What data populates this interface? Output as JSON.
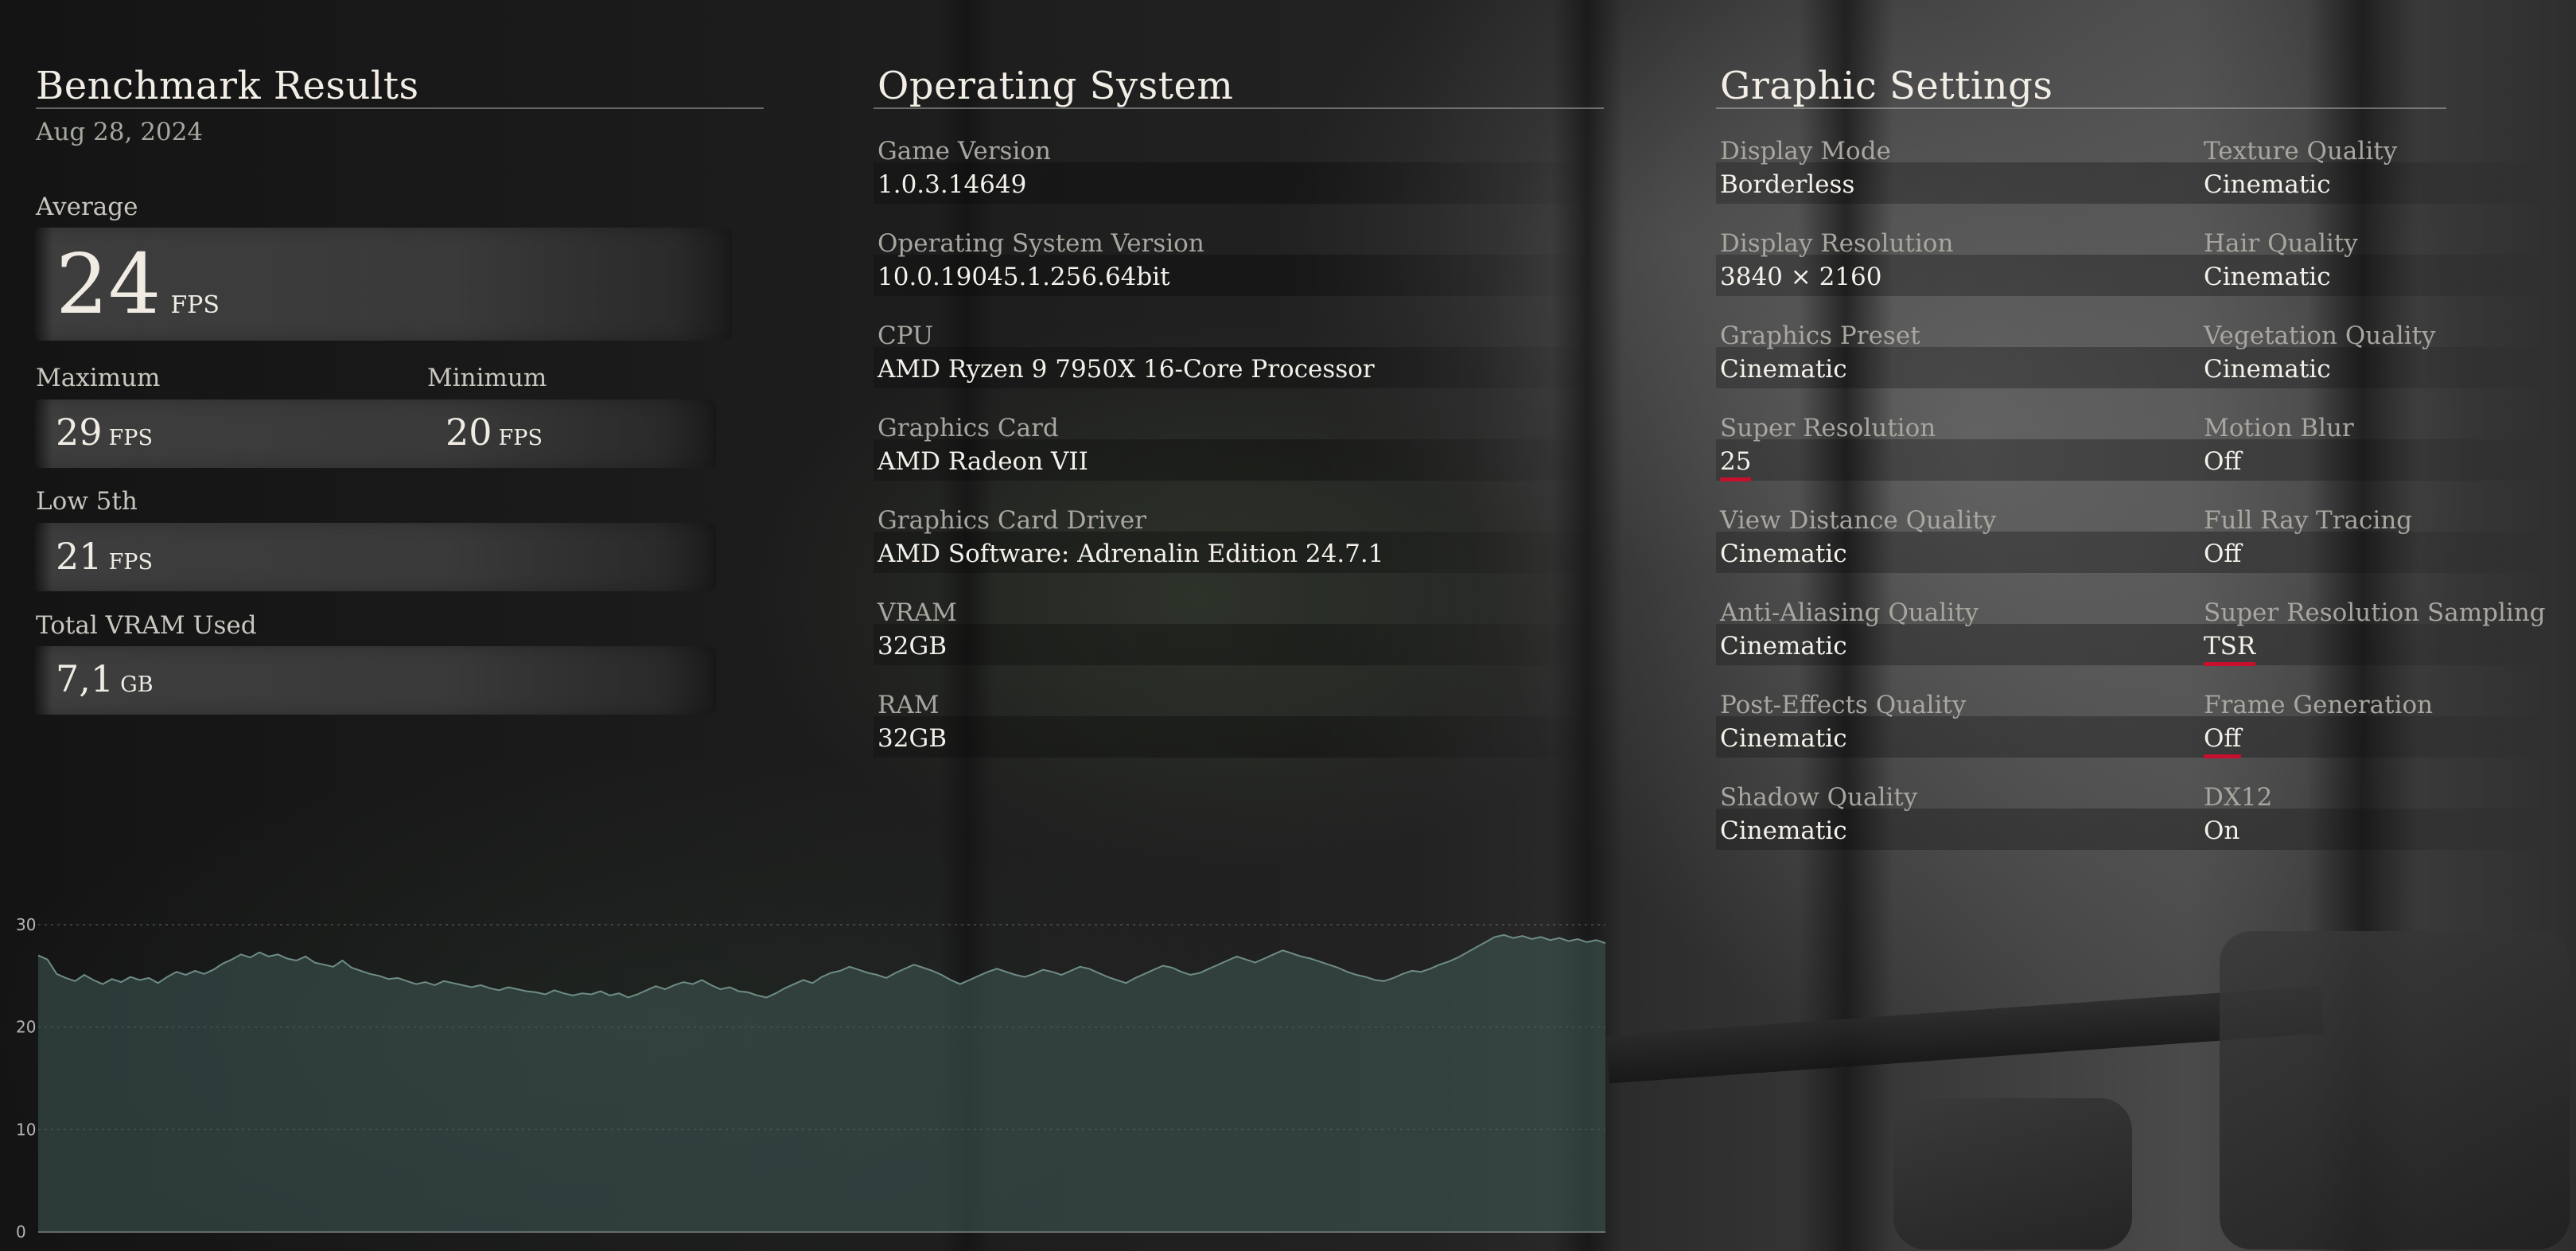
{
  "benchmark": {
    "title": "Benchmark Results",
    "date": "Aug 28, 2024",
    "average": {
      "label": "Average",
      "value": "24",
      "unit": "FPS"
    },
    "maximum": {
      "label": "Maximum",
      "value": "29",
      "unit": "FPS"
    },
    "minimum": {
      "label": "Minimum",
      "value": "20",
      "unit": "FPS"
    },
    "low5": {
      "label": "Low 5th",
      "value": "21",
      "unit": "FPS"
    },
    "vram_used": {
      "label": "Total VRAM Used",
      "value": "7,1",
      "unit": "GB"
    }
  },
  "os": {
    "title": "Operating System",
    "fields": [
      {
        "label": "Game Version",
        "value": "1.0.3.14649"
      },
      {
        "label": "Operating System Version",
        "value": "10.0.19045.1.256.64bit"
      },
      {
        "label": "CPU",
        "value": "AMD Ryzen 9 7950X 16-Core Processor"
      },
      {
        "label": "Graphics Card",
        "value": "AMD Radeon VII"
      },
      {
        "label": "Graphics Card Driver",
        "value": "AMD Software: Adrenalin Edition 24.7.1"
      },
      {
        "label": "VRAM",
        "value": "32GB"
      },
      {
        "label": "RAM",
        "value": "32GB"
      }
    ]
  },
  "graphics": {
    "title": "Graphic Settings",
    "left": [
      {
        "label": "Display Mode",
        "value": "Borderless"
      },
      {
        "label": "Display Resolution",
        "value": "3840 × 2160"
      },
      {
        "label": "Graphics Preset",
        "value": "Cinematic"
      },
      {
        "label": "Super Resolution",
        "value": "25",
        "highlighted": true
      },
      {
        "label": "View Distance Quality",
        "value": "Cinematic"
      },
      {
        "label": "Anti-Aliasing Quality",
        "value": "Cinematic"
      },
      {
        "label": "Post-Effects Quality",
        "value": "Cinematic"
      },
      {
        "label": "Shadow Quality",
        "value": "Cinematic"
      }
    ],
    "right": [
      {
        "label": "Texture Quality",
        "value": "Cinematic"
      },
      {
        "label": "Hair Quality",
        "value": "Cinematic"
      },
      {
        "label": "Vegetation Quality",
        "value": "Cinematic"
      },
      {
        "label": "Motion Blur",
        "value": "Off"
      },
      {
        "label": "Full Ray Tracing",
        "value": "Off"
      },
      {
        "label": "Super Resolution Sampling",
        "value": "TSR",
        "highlighted": true
      },
      {
        "label": "Frame Generation",
        "value": "Off",
        "highlighted": true
      },
      {
        "label": "DX12",
        "value": "On"
      }
    ],
    "highlight_color": "#c8102e"
  },
  "chart_data": {
    "type": "area",
    "ylim": [
      0,
      30
    ],
    "yticks": [
      0,
      10,
      20,
      30
    ],
    "grid": true,
    "fill_color": "#3f5a55",
    "line_color": "#6f8c86",
    "values": [
      27,
      26.6,
      25.2,
      24.8,
      24.5,
      25.1,
      24.6,
      24.2,
      24.7,
      24.4,
      24.9,
      24.6,
      24.8,
      24.3,
      24.9,
      25.4,
      25.1,
      25.5,
      25.2,
      25.6,
      26.2,
      26.6,
      27.1,
      26.8,
      27.3,
      26.9,
      27.1,
      26.7,
      26.5,
      26.9,
      26.3,
      26.1,
      25.9,
      26.5,
      25.8,
      25.5,
      25.2,
      25,
      24.7,
      24.8,
      24.5,
      24.2,
      24.4,
      24.1,
      24.5,
      24.3,
      24.1,
      23.9,
      24.1,
      23.8,
      23.6,
      23.9,
      23.7,
      23.5,
      23.4,
      23.2,
      23.6,
      23.3,
      23.1,
      23.3,
      23.2,
      23.5,
      23.1,
      23.3,
      22.9,
      23.2,
      23.6,
      24,
      23.7,
      24.1,
      24.4,
      24.2,
      24.6,
      24.1,
      23.7,
      23.9,
      23.5,
      23.4,
      23.1,
      22.9,
      23.3,
      23.8,
      24.2,
      24.6,
      24.3,
      24.9,
      25.3,
      25.5,
      25.9,
      25.6,
      25.3,
      25.1,
      24.8,
      25.3,
      25.7,
      26.1,
      25.8,
      25.5,
      25.1,
      24.6,
      24.2,
      24.6,
      25,
      25.4,
      25.7,
      25.4,
      25.1,
      24.9,
      25.2,
      25.6,
      25.4,
      25.1,
      25.5,
      25.9,
      25.7,
      25.3,
      24.9,
      24.6,
      24.3,
      24.8,
      25.2,
      25.6,
      26,
      25.8,
      25.4,
      25.1,
      25.3,
      25.7,
      26.1,
      26.5,
      26.9,
      26.6,
      26.3,
      26.7,
      27.1,
      27.5,
      27.2,
      26.9,
      26.7,
      26.4,
      26.1,
      25.8,
      25.4,
      25.1,
      24.9,
      24.6,
      24.5,
      24.8,
      25.2,
      25.5,
      25.4,
      25.7,
      26.1,
      26.4,
      26.8,
      27.3,
      27.8,
      28.3,
      28.8,
      29,
      28.7,
      28.9,
      28.6,
      28.8,
      28.5,
      28.7,
      28.4,
      28.6,
      28.3,
      28.5,
      28.2
    ]
  }
}
